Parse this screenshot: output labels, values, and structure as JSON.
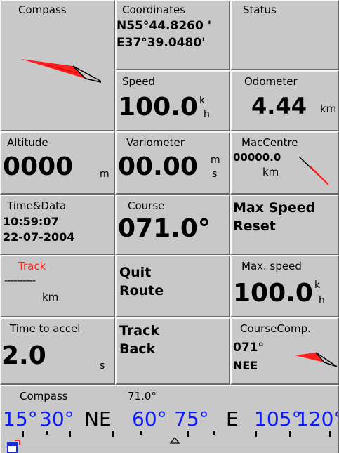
{
  "panels": {
    "coordinates": {
      "label": "Coordinates",
      "lat": "N55°44.8260 '",
      "lon": "E37°39.0480'"
    },
    "compass": {
      "label": "Compass"
    },
    "status": {
      "label": "Status"
    },
    "speed": {
      "label": "Speed",
      "value": "100.0",
      "unit_top": "k",
      "unit_bottom": "h"
    },
    "odometer": {
      "label": "Odometer",
      "value": "4.44",
      "unit": "km"
    },
    "altitude": {
      "label": "Altitude",
      "value": "0000",
      "unit": "m"
    },
    "variometer": {
      "label": "Variometer",
      "value": "00.00",
      "unit_top": "m",
      "unit_bottom": "s"
    },
    "maccentre": {
      "label": "MacCentre",
      "value": "00000.0",
      "unit": "km"
    },
    "timedata": {
      "label": "Time&Data",
      "time": "10:59:07",
      "date": "22-07-2004"
    },
    "course": {
      "label": "Course",
      "value": "071.0°"
    },
    "maxspeed_reset": {
      "line1": "Max Speed",
      "line2": "Reset"
    },
    "track": {
      "label": "Track",
      "value": "----------",
      "unit": "km"
    },
    "quit_route": {
      "line1": "Quit",
      "line2": "Route"
    },
    "max_speed": {
      "label": "Max. speed",
      "value": "100.0",
      "unit_top": "k",
      "unit_bottom": "h"
    },
    "time_to_accel": {
      "label": "Time to accel",
      "value": "2.0",
      "unit": "s"
    },
    "track_back": {
      "line1": "Track",
      "line2": "Back"
    },
    "coursecomp": {
      "label": "CourseComp.",
      "value": "071°",
      "dir": "NEE"
    }
  },
  "compass_strip": {
    "label": "Compass",
    "heading": "71.0°",
    "marks": [
      "15°",
      "30°",
      "NE",
      "60°",
      "75°",
      "E",
      "105°",
      "120°"
    ]
  },
  "colors": {
    "panel": "#c8c8c8",
    "accent_red": "#ff1f1f",
    "degree_blue": "#0a1cff"
  },
  "icons": [
    "compass-needle-icon",
    "direction-arrow-icon",
    "window-restore-icon"
  ]
}
